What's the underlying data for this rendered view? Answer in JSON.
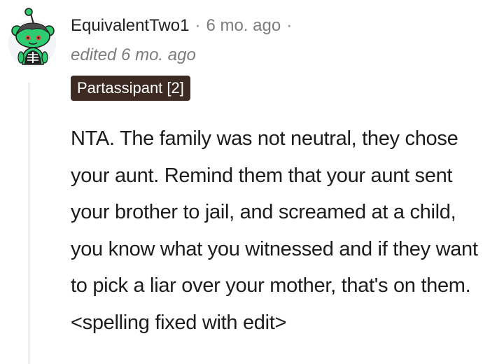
{
  "comment": {
    "username": "EquivalentTwo1",
    "separator": "·",
    "timestamp": "6 mo. ago",
    "trailing_separator": "·",
    "edited_label": "edited 6 mo. ago",
    "flair": "Partassipant [2]",
    "body": "NTA. The family was not neutral, they chose your aunt. Remind them that your aunt sent your brother to jail, and screamed at a child, you know what you witnessed and if they want to pick a liar over your mother, that's on them.<spelling fixed with edit>"
  },
  "colors": {
    "flair_background": "#3d2a22",
    "avatar_green": "#2ecc71",
    "avatar_red": "#e74c3c",
    "text_primary": "#1c1c1c",
    "text_meta": "#7c7c7c"
  },
  "icons": {
    "avatar": "snoo-avatar-icon"
  }
}
